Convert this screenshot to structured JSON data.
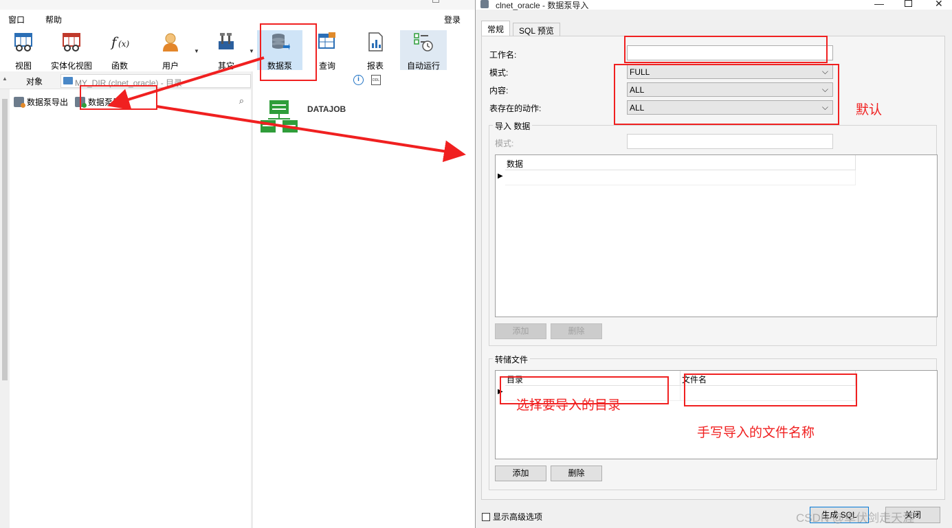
{
  "menubar": {
    "window": "窗口",
    "help": "帮助",
    "login": "登录"
  },
  "toolbar": {
    "buttons": [
      {
        "label": "视图"
      },
      {
        "label": "实体化视图"
      },
      {
        "label": "函数"
      },
      {
        "label": "用户"
      },
      {
        "label": "其它"
      },
      {
        "label": "数据泵"
      },
      {
        "label": "查询"
      },
      {
        "label": "报表"
      },
      {
        "label": "自动运行"
      }
    ],
    "active_button": "数据泵"
  },
  "sidebar": {
    "tab": "对象",
    "breadcrumb": "MY_DIR (clnet_oracle) - 目录",
    "export_button": "数据泵导出",
    "import_button": "数据泵导入"
  },
  "content": {
    "job_name": "DATAJOB"
  },
  "dialog": {
    "title": "clnet_oracle - 数据泵导入",
    "tabs": [
      "常规",
      "SQL 预览"
    ],
    "fields": {
      "job_name_label": "工作名:",
      "job_name_value": "",
      "mode_label": "模式:",
      "mode_value": "FULL",
      "content_label": "内容:",
      "content_value": "ALL",
      "table_action_label": "表存在的动作:",
      "table_action_value": "ALL"
    },
    "import_group": {
      "title": "导入 数据",
      "schema_label": "模式:",
      "column": "数据",
      "add_button": "添加",
      "delete_button": "删除"
    },
    "dump_group": {
      "title": "转储文件",
      "columns": [
        "目录",
        "文件名"
      ],
      "add_button": "添加",
      "delete_button": "删除"
    },
    "advanced_checkbox": "显示高级选项",
    "generate_sql_button": "生成 SQL",
    "close_button": "关闭"
  },
  "annotations": {
    "default": "默认",
    "directory": "选择要导入的目录",
    "filename": "手写导入的文件名称",
    "color": "#f02020"
  },
  "watermark": "CSDN @卓伏剑走天涯"
}
